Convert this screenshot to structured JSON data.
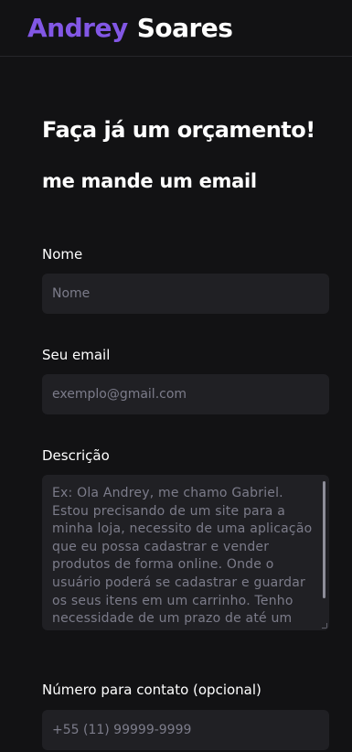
{
  "header": {
    "brand_first": "Andrey",
    "brand_last": "Soares",
    "accent_color": "#8257e5"
  },
  "main": {
    "title": "Faça já um orçamento!",
    "subtitle": "me mande um email"
  },
  "form": {
    "name_label": "Nome",
    "name_placeholder": "Nome",
    "email_label": "Seu email",
    "email_placeholder": "exemplo@gmail.com",
    "description_label": "Descrição",
    "description_placeholder": "Ex: Ola Andrey, me chamo Gabriel. Estou precisando de um site para a minha loja, necessito de uma aplicação que eu possa cadastrar e vender produtos de forma online. Onde o usuário poderá se cadastrar e guardar os seus itens em um carrinho. Tenho necessidade de um prazo de até um",
    "phone_label": "Número para contato (opcional)",
    "phone_placeholder": "+55 (11) 99999-9999"
  }
}
